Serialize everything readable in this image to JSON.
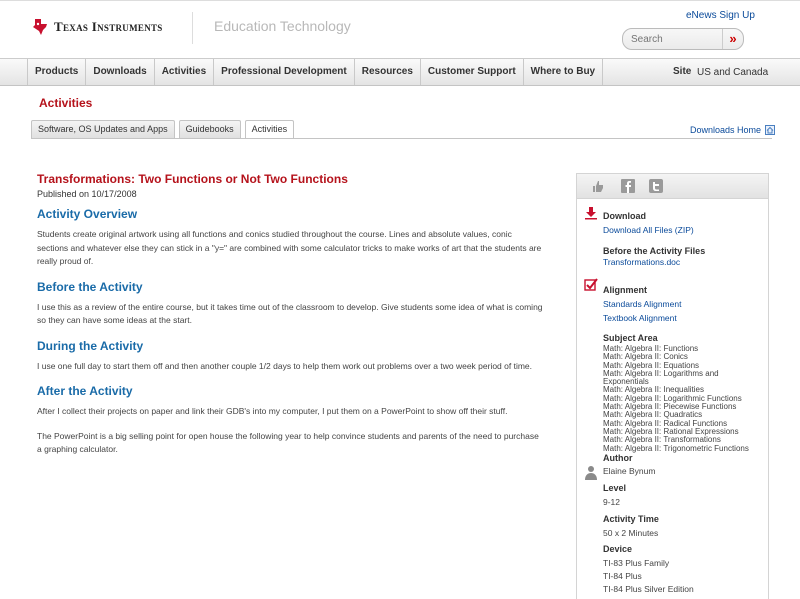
{
  "header": {
    "brand": "Texas Instruments",
    "section": "Education Technology",
    "enews": "eNews Sign Up",
    "search_placeholder": "Search",
    "search_go": "»"
  },
  "nav": {
    "items": [
      "Products",
      "Downloads",
      "Activities",
      "Professional Development",
      "Resources",
      "Customer Support",
      "Where to Buy"
    ],
    "site_label": "Site",
    "site_value": "US and Canada"
  },
  "page": {
    "title": "Activities",
    "tabs": [
      "Software, OS Updates and Apps",
      "Guidebooks",
      "Activities"
    ],
    "active_tab": "Activities",
    "downloads_home": "Downloads Home"
  },
  "activity": {
    "title": "Transformations: Two Functions or Not Two Functions",
    "published": "Published on 10/17/2008",
    "sections": [
      {
        "heading": "Activity Overview",
        "paragraphs": [
          "Students create original artwork using all functions and conics studied throughout the course. Lines and absolute values, conic sections and whatever else they can stick in a \"y=\" are combined with some calculator tricks to make works of art that the students are really proud of."
        ]
      },
      {
        "heading": "Before the Activity",
        "paragraphs": [
          "I use this as a review of the entire course, but it takes time out of the classroom to develop. Give students some idea of what is coming so they can have some ideas at the start."
        ]
      },
      {
        "heading": "During the Activity",
        "paragraphs": [
          "I use one full day to start them off and then another couple 1/2 days to help them work out problems over a two week period of time."
        ]
      },
      {
        "heading": "After the Activity",
        "paragraphs": [
          "After I collect their projects on paper and link their GDB's into my computer, I put them on a PowerPoint to show off their stuff.",
          "The PowerPoint is a big selling point for open house the following year to help convince students and parents of the need to purchase a graphing calculator."
        ]
      }
    ]
  },
  "sidebar": {
    "download_h": "Download",
    "download_link": "Download All Files (ZIP)",
    "before_h": "Before the Activity Files",
    "before_link": "Transformations.doc",
    "alignment_h": "Alignment",
    "standards_link": "Standards Alignment",
    "textbook_link": "Textbook Alignment",
    "subject_h": "Subject Area",
    "subjects": [
      "Math: Algebra II: Functions",
      "Math: Algebra II: Conics",
      "Math: Algebra II: Equations",
      "Math: Algebra II: Logarithms and",
      "Exponentials",
      "Math: Algebra II: Inequalities",
      "Math: Algebra II: Logarithmic Functions",
      "Math: Algebra II: Piecewise Functions",
      "Math: Algebra II: Quadratics",
      "Math: Algebra II: Radical Functions",
      "Math: Algebra II: Rational Expressions",
      "Math: Algebra II: Transformations",
      "Math: Algebra II: Trigonometric Functions"
    ],
    "author_h": "Author",
    "author": "Elaine Bynum",
    "level_h": "Level",
    "level": "9-12",
    "time_h": "Activity Time",
    "time": "50 x 2 Minutes",
    "device_h": "Device",
    "devices": [
      "TI-83 Plus Family",
      "TI-84 Plus",
      "TI-84 Plus Silver Edition"
    ]
  },
  "colors": {
    "accent_red": "#b5121b",
    "link_blue": "#0a4a9a",
    "heading_blue": "#1a6ba8"
  }
}
